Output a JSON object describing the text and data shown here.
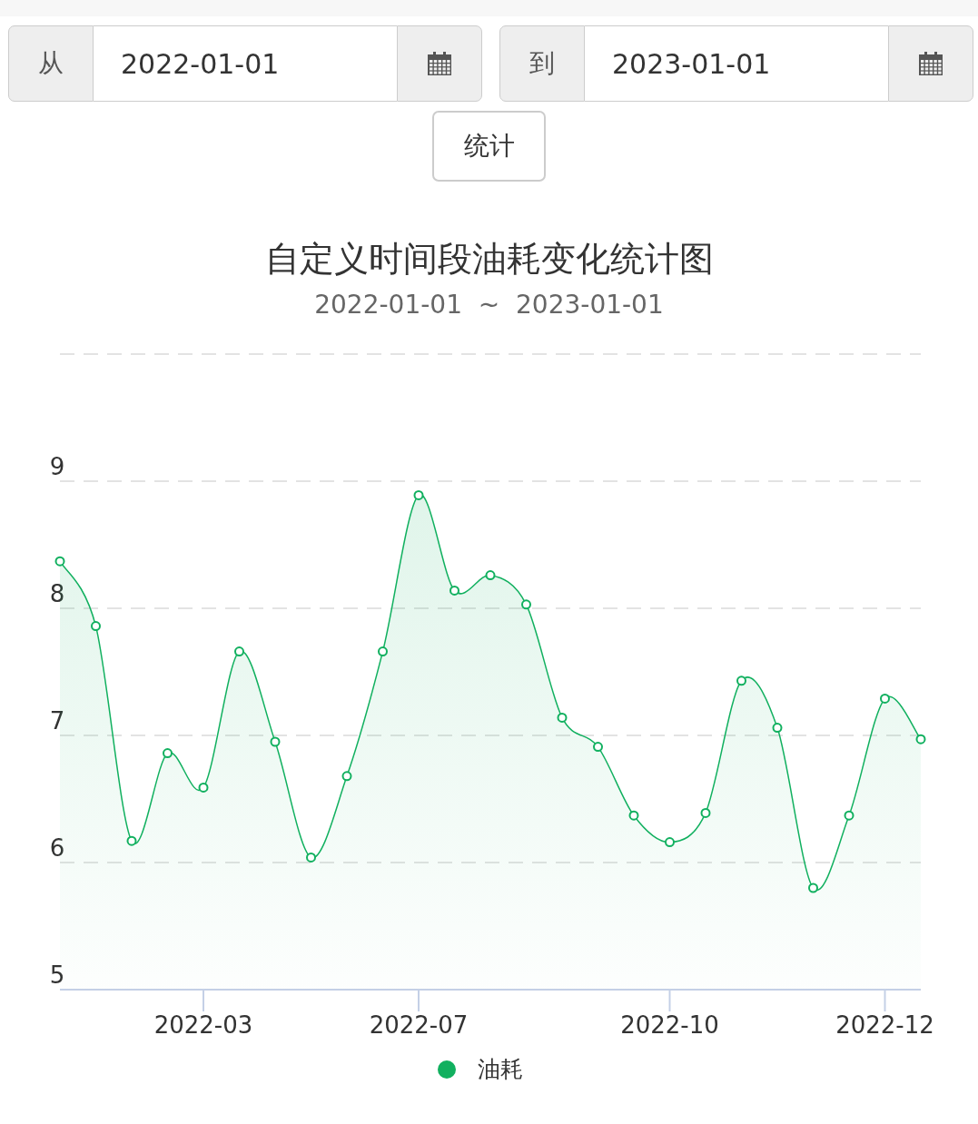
{
  "date_range": {
    "from": {
      "label": "从",
      "value": "2022-01-01"
    },
    "to": {
      "label": "到",
      "value": "2023-01-01"
    }
  },
  "submit_button": "统计",
  "chart": {
    "subtitle": "2022-01-01  ~  2023-01-01",
    "chart_data": {
      "type": "area",
      "title": "自定义时间段油耗变化统计图",
      "categories": [
        null,
        null,
        null,
        null,
        "2022-03",
        null,
        null,
        null,
        null,
        null,
        "2022-07",
        null,
        null,
        null,
        null,
        null,
        null,
        "2022-10",
        null,
        null,
        null,
        null,
        null,
        "2022-12",
        null
      ],
      "series": [
        {
          "name": "油耗",
          "color": "#11b05f",
          "values": [
            8.37,
            7.86,
            6.17,
            6.86,
            6.59,
            7.66,
            6.95,
            6.04,
            6.68,
            7.66,
            8.89,
            8.14,
            8.26,
            8.03,
            7.14,
            6.91,
            6.37,
            6.16,
            6.39,
            7.43,
            7.06,
            5.8,
            6.37,
            7.29,
            6.97
          ]
        }
      ],
      "ylim": [
        5,
        10
      ],
      "grid": true,
      "yticks": [
        5,
        6,
        7,
        8,
        9
      ]
    }
  }
}
